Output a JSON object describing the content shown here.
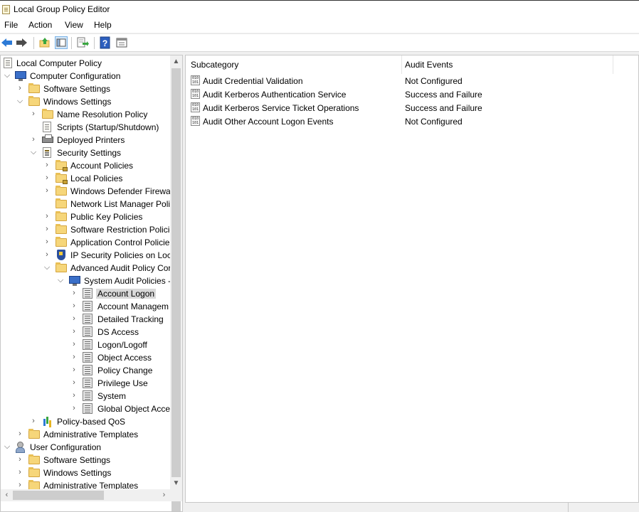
{
  "window": {
    "title": "Local Group Policy Editor"
  },
  "menu": {
    "file": "File",
    "action": "Action",
    "view": "View",
    "help": "Help"
  },
  "toolbar": {
    "buttons": [
      "back-icon",
      "forward-icon",
      "up-one-level-icon",
      "show-hide-tree-icon",
      "export-list-icon",
      "help-icon",
      "properties-icon"
    ]
  },
  "tree": {
    "root": "Local Computer Policy",
    "computer_configuration": "Computer Configuration",
    "cc_software_settings": "Software Settings",
    "cc_windows_settings": "Windows Settings",
    "name_resolution_policy": "Name Resolution Policy",
    "scripts": "Scripts (Startup/Shutdown)",
    "deployed_printers": "Deployed Printers",
    "security_settings": "Security Settings",
    "account_policies": "Account Policies",
    "local_policies": "Local Policies",
    "windows_defender_firewall": "Windows Defender Firewall",
    "network_list_manager": "Network List Manager Poli",
    "public_key_policies": "Public Key Policies",
    "software_restriction": "Software Restriction Policie",
    "application_control": "Application Control Policie",
    "ip_security": "IP Security Policies on Loca",
    "advanced_audit": "Advanced Audit Policy Cor",
    "system_audit_policies": "System Audit Policies -",
    "account_logon": "Account Logon",
    "account_management": "Account Managem",
    "detailed_tracking": "Detailed Tracking",
    "ds_access": "DS Access",
    "logon_logoff": "Logon/Logoff",
    "object_access": "Object Access",
    "policy_change": "Policy Change",
    "privilege_use": "Privilege Use",
    "system": "System",
    "global_object_access": "Global Object Acce",
    "policy_based_qos": "Policy-based QoS",
    "cc_admin_templates": "Administrative Templates",
    "user_configuration": "User Configuration",
    "uc_software_settings": "Software Settings",
    "uc_windows_settings": "Windows Settings",
    "uc_admin_templates": "Administrative Templates",
    "selected": "Account Logon"
  },
  "details": {
    "columns": {
      "subcategory": "Subcategory",
      "audit_events": "Audit Events"
    },
    "rows": [
      {
        "subcategory": "Audit Credential Validation",
        "audit_events": "Not Configured"
      },
      {
        "subcategory": "Audit Kerberos Authentication Service",
        "audit_events": "Success and Failure"
      },
      {
        "subcategory": "Audit Kerberos Service Ticket Operations",
        "audit_events": "Success and Failure"
      },
      {
        "subcategory": "Audit Other Account Logon Events",
        "audit_events": "Not Configured"
      }
    ]
  }
}
